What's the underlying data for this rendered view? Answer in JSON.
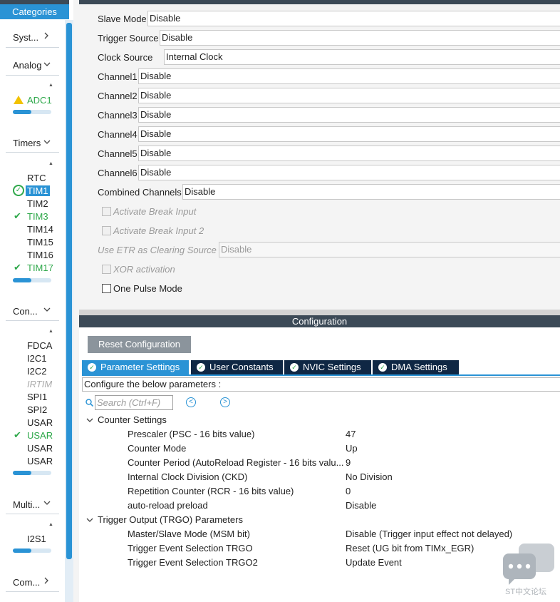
{
  "sidebar": {
    "header": "Categories",
    "sections": [
      {
        "title": "Syst...",
        "collapsed": true
      },
      {
        "title": "Analog",
        "collapsed": false,
        "items": [
          "ADC1"
        ]
      },
      {
        "title": "Timers",
        "collapsed": false,
        "items": [
          "RTC",
          "TIM1",
          "TIM2",
          "TIM3",
          "TIM14",
          "TIM15",
          "TIM16",
          "TIM17"
        ]
      },
      {
        "title": "Con...",
        "collapsed": false,
        "items": [
          "FDCA",
          "I2C1",
          "I2C2",
          "IRTIM",
          "SPI1",
          "SPI2",
          "USAR",
          "USAR",
          "USAR",
          "USAR"
        ]
      },
      {
        "title": "Multi...",
        "collapsed": false,
        "items": [
          "I2S1"
        ]
      },
      {
        "title": "Com...",
        "collapsed": true
      }
    ]
  },
  "mode": {
    "rows": [
      {
        "label": "Slave Mode",
        "value": "Disable"
      },
      {
        "label": "Trigger Source",
        "value": "Disable"
      },
      {
        "label": "Clock Source",
        "value": "Internal Clock"
      },
      {
        "label": "Channel1",
        "value": "Disable"
      },
      {
        "label": "Channel2",
        "value": "Disable"
      },
      {
        "label": "Channel3",
        "value": "Disable"
      },
      {
        "label": "Channel4",
        "value": "Disable"
      },
      {
        "label": "Channel5",
        "value": "Disable"
      },
      {
        "label": "Channel6",
        "value": "Disable"
      },
      {
        "label": "Combined Channels",
        "value": "Disable"
      }
    ],
    "break_input": "Activate Break Input",
    "break_input2": "Activate Break Input 2",
    "etr_label": "Use ETR as Clearing Source",
    "etr_value": "Disable",
    "xor": "XOR activation",
    "one_pulse": "One Pulse Mode"
  },
  "configuration": {
    "title": "Configuration",
    "reset_button": "Reset Configuration",
    "tabs": [
      "Parameter Settings",
      "User Constants",
      "NVIC Settings",
      "DMA Settings"
    ],
    "intro": "Configure the below parameters :",
    "search_placeholder": "Search (Ctrl+F)",
    "groups": [
      {
        "title": "Counter Settings",
        "params": [
          {
            "name": "Prescaler (PSC - 16 bits value)",
            "value": "47"
          },
          {
            "name": "Counter Mode",
            "value": "Up"
          },
          {
            "name": "Counter Period (AutoReload Register - 16 bits valu...",
            "value": "9"
          },
          {
            "name": "Internal Clock Division (CKD)",
            "value": "No Division"
          },
          {
            "name": "Repetition Counter (RCR - 16 bits value)",
            "value": "0"
          },
          {
            "name": "auto-reload preload",
            "value": "Disable"
          }
        ]
      },
      {
        "title": "Trigger Output (TRGO) Parameters",
        "params": [
          {
            "name": "Master/Slave Mode (MSM bit)",
            "value": "Disable (Trigger input effect not delayed)"
          },
          {
            "name": "Trigger Event Selection TRGO",
            "value": "Reset (UG bit from TIMx_EGR)"
          },
          {
            "name": "Trigger Event Selection TRGO2",
            "value": "Update Event"
          }
        ]
      }
    ]
  },
  "watermark": "ST中文论坛",
  "colors": {
    "accent": "#2a93d5",
    "dark_header": "#3c4a57",
    "tab_dark": "#0f2744",
    "ok_green": "#2ea84a",
    "warn_yellow": "#f2c200"
  }
}
